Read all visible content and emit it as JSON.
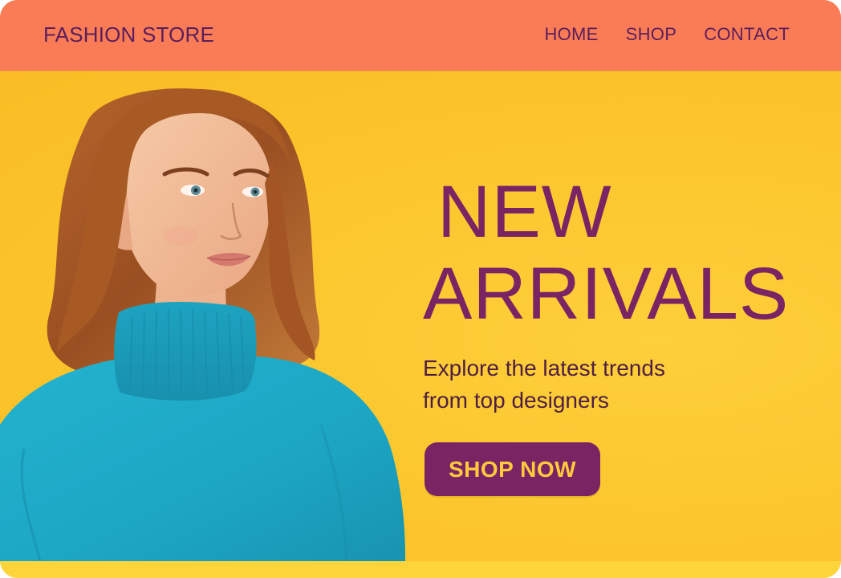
{
  "header": {
    "brand": "FASHION STORE",
    "nav": [
      {
        "label": "HOME"
      },
      {
        "label": "SHOP"
      },
      {
        "label": "CONTACT"
      }
    ]
  },
  "hero": {
    "headline_line1": "NEW",
    "headline_line2": "ARRIVALS",
    "subtitle": "Explore the latest trends from top designers",
    "cta_label": "SHOP NOW",
    "photo_alt": "Model wearing a turquoise turtleneck sweater"
  },
  "colors": {
    "navbar": "#FA7C57",
    "hero_background": "#FCC72E",
    "accent_purple": "#7A2464",
    "button_text": "#FCCB3C",
    "sweater": "#1CA6C4"
  }
}
